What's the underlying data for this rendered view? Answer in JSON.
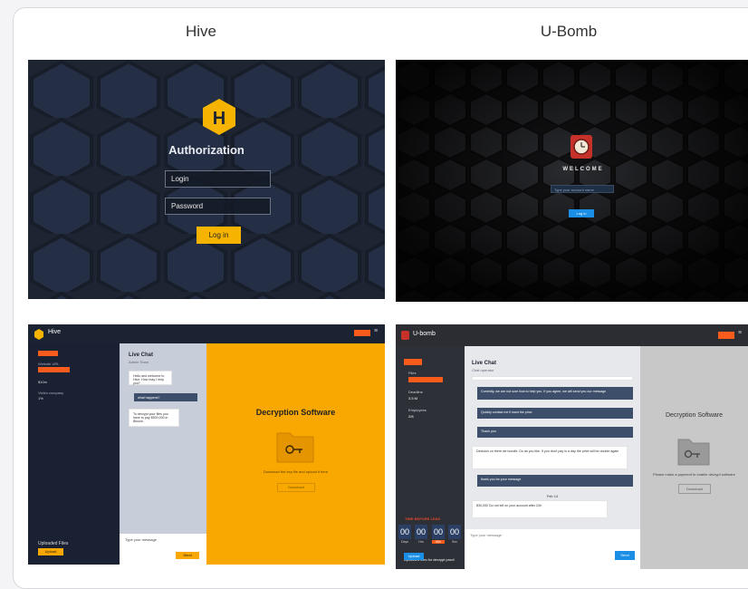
{
  "columns": {
    "left_title": "Hive",
    "right_title": "U-Bomb"
  },
  "hive_login": {
    "logo_letter": "H",
    "title": "Authorization",
    "login_placeholder": "Login",
    "password_placeholder": "Password",
    "login_button": "Log in"
  },
  "ubomb_login": {
    "welcome": "WELCOME",
    "input_placeholder": "Type your account name",
    "button": "Log in"
  },
  "hive_chat": {
    "app_name": "Hive",
    "side_labels": [
      "Website URL",
      "$10m",
      "Victim company",
      "1%"
    ],
    "uploaded_files": "Uploaded Files",
    "upload_button": "Upload",
    "chat_title": "Live Chat",
    "chat_sub": "Admin Team",
    "messages": [
      "Hello and welcome to Hive. How may I help you?",
      "what happens?",
      "To decrypt your files you have to pay $500,000 in Bitcoin."
    ],
    "input_placeholder": "Type your message",
    "send": "Send",
    "main_title": "Decryption Software",
    "main_text": "Download the key file and upload it here",
    "main_button": "Download"
  },
  "ubomb_chat": {
    "app_name": "U-bomb",
    "side_labels": [
      "Files",
      "Deadline",
      "3.5 M",
      "Employees",
      "2/8"
    ],
    "timer_title": "TIME BEFORE LEAK",
    "timer_values": [
      "00",
      "00",
      "00",
      "00"
    ],
    "timer_labels": [
      "Days",
      "Hrs",
      "Min",
      "Sec"
    ],
    "uploaded_files": "Uploaded files for decrypt proof",
    "upload_button": "Upload",
    "chat_title": "Live Chat",
    "chat_sub": "Chat operator",
    "messages": [
      "Currently, we are not sure how to help you. If you agree, we will send you our message",
      "Quickly contact me if want the price",
      "Thank you",
      "Decision on there we bundle. Do as you like. If you don't pay in a day the price will be double again",
      "thank you for your message",
      "$30,000 Do not tell on your account after 24h"
    ],
    "day_label": "Feb 14",
    "input_placeholder": "Type your message",
    "send": "Send",
    "main_title": "Decryption Software",
    "main_text": "Please make a payment to enable decrypt software",
    "main_button": "Download"
  }
}
